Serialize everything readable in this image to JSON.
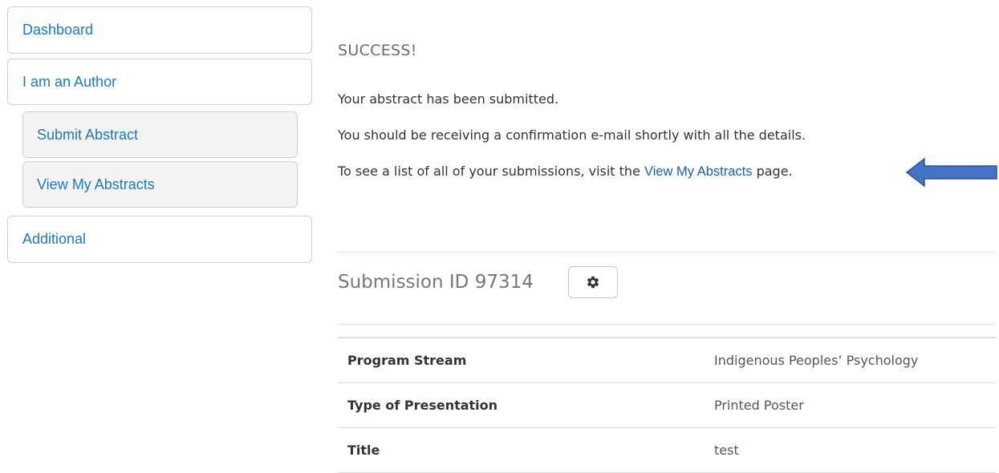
{
  "sidebar": {
    "items": [
      {
        "label": "Dashboard"
      },
      {
        "label": "I am an Author"
      },
      {
        "label": "Additional"
      }
    ],
    "subitems": [
      {
        "label": "Submit Abstract"
      },
      {
        "label": "View My Abstracts"
      }
    ]
  },
  "main": {
    "heading": "SUCCESS!",
    "line1": "Your abstract has been submitted.",
    "line2": "You should be receiving a confirmation e-mail shortly with all the details.",
    "line3_before": "To see a list of all of your submissions, visit the ",
    "line3_link": "View My Abstracts",
    "line3_after": " page.",
    "submission_label": "Submission ID 97314",
    "settings_icon": "gear-icon"
  },
  "details": [
    {
      "label": "Program Stream",
      "value": "Indigenous Peoples’ Psychology"
    },
    {
      "label": "Type of Presentation",
      "value": "Printed Poster"
    },
    {
      "label": "Title",
      "value": "test"
    }
  ],
  "colors": {
    "link": "#1a7bbf",
    "arrow": "#4472c4"
  }
}
